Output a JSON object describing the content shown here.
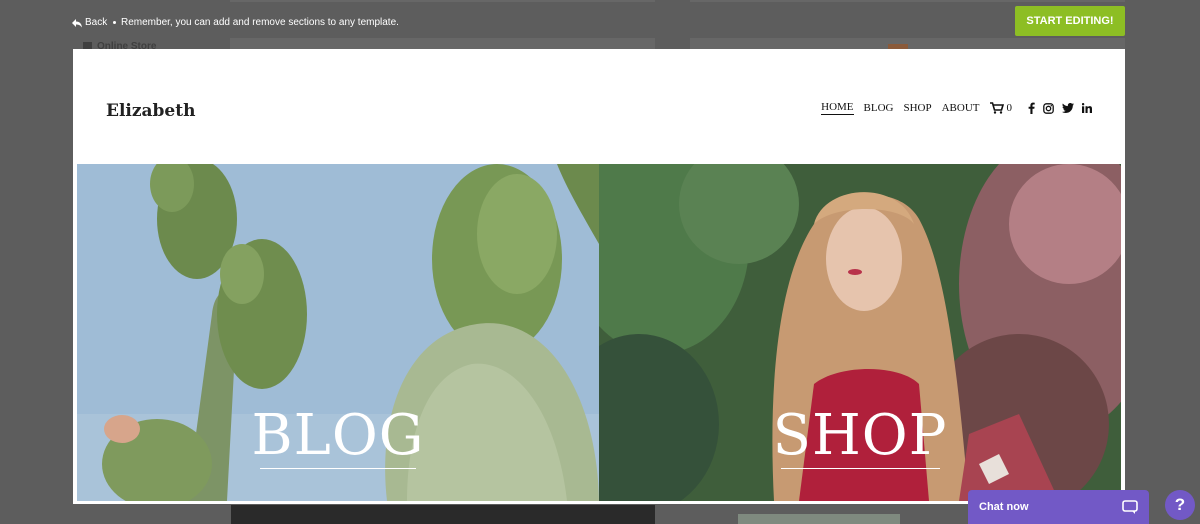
{
  "topbar": {
    "back_label": "Back",
    "reminder": "Remember, you can add and remove sections to any template.",
    "start_button": "START EDITING!",
    "accent": "#8dbe24"
  },
  "background_editor": {
    "nav_label": "Online Store"
  },
  "site": {
    "logo": "Elizabeth",
    "nav": [
      {
        "label": "HOME",
        "active": true
      },
      {
        "label": "BLOG",
        "active": false
      },
      {
        "label": "SHOP",
        "active": false
      },
      {
        "label": "ABOUT",
        "active": false
      }
    ],
    "cart_count": "0",
    "social_icons": [
      "facebook-icon",
      "instagram-icon",
      "twitter-icon",
      "linkedin-icon"
    ]
  },
  "hero": {
    "blog_label": "BLOG",
    "shop_label": "SHOP"
  },
  "chat": {
    "label": "Chat now",
    "help": "?",
    "color": "#7259c6"
  }
}
